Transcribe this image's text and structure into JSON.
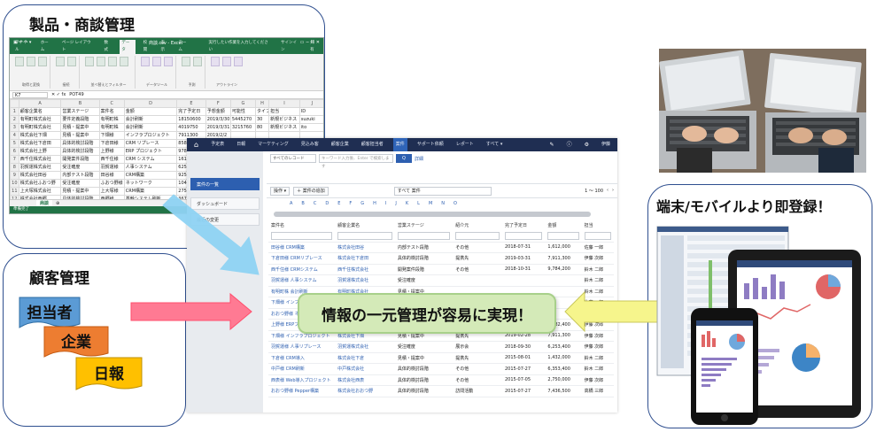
{
  "sections": {
    "product": "製品・商談管理",
    "customer": "顧客管理",
    "mobile": "端末/モバイルより即登録！"
  },
  "banner": "情報の一元管理が容易に実現！",
  "customer_tags": [
    "担当者",
    "企業",
    "日報"
  ],
  "excel": {
    "title": "商談.csv - Excel",
    "tell_me": "実行したい作業を入力してください",
    "sign_in": "サインイン",
    "share": "共有",
    "tabs": [
      "ファイル",
      "ホーム",
      "ページ レイアウト",
      "数式",
      "データ",
      "校閲",
      "表示",
      "チーム"
    ],
    "active_tab": "データ",
    "ribbon_groups": [
      "取得と変換",
      "接続",
      "並べ替えとフィルター",
      "データツール",
      "予測",
      "アウトライン"
    ],
    "name_box": "K7",
    "formula": "POT49",
    "columns": [
      "",
      "A",
      "B",
      "C",
      "D",
      "E",
      "F",
      "G",
      "H",
      "I",
      "J"
    ],
    "rows": [
      [
        "1",
        "顧客企業名",
        "営業ステージ",
        "案件名",
        "金額",
        "完了予定日",
        "予想金額",
        "可能性",
        "タイプ",
        "担当",
        "ID"
      ],
      [
        "2",
        "有明町株式会社",
        "要件定義段階",
        "有明町株",
        "会計刷新",
        "18150600",
        "2019/3/30",
        "5445270",
        "30",
        "新規ビジネス",
        "suzuki"
      ],
      [
        "3",
        "有明町株式会社",
        "見積・提案中",
        "有明町株",
        "会計刷新",
        "4019750",
        "2019/3/31",
        "3215760",
        "80",
        "新規ビジネス",
        "ito"
      ],
      [
        "4",
        "株式会社下畑",
        "見積・提案中",
        "下畑様",
        "インフラプロジェクト",
        "7911300",
        "2019/2/2",
        "",
        "",
        "",
        ""
      ],
      [
        "5",
        "株式会社下倉田",
        "具体的検討段階",
        "下倉田様",
        "CRM リプレース",
        "8582400",
        "",
        "",
        "",
        "",
        ""
      ],
      [
        "6",
        "株式会社上野",
        "具体的検討段階",
        "上野様",
        "ERP プロジェクト",
        "9784200",
        "",
        "",
        "",
        "",
        ""
      ],
      [
        "7",
        "西千住株式会社",
        "開発案件段階",
        "西千住様",
        "CRM システム",
        "1612000",
        "",
        "",
        "",
        "",
        ""
      ],
      [
        "8",
        "羽賀運株式会社",
        "受注確度",
        "羽賀運様",
        "人事システム",
        "6253400",
        "",
        "",
        "",
        "",
        ""
      ],
      [
        "9",
        "株式会社田谷",
        "内部テスト段階",
        "田谷様",
        "CRM構築",
        "9259800",
        "",
        "",
        "",
        "",
        ""
      ],
      [
        "10",
        "株式会社ふおつ野",
        "受注確度",
        "ふおつ野様",
        "ネットワーク",
        "1043900",
        "",
        "",
        "",
        "",
        ""
      ],
      [
        "11",
        "上大塚株式会社",
        "見積・提案中",
        "上大塚様",
        "CRM構築",
        "2750000",
        "",
        "",
        "",
        "",
        ""
      ],
      [
        "12",
        "株式会社西郷",
        "具体的検討段階",
        "西郷様",
        "基幹システム刷新",
        "3678000",
        "",
        "",
        "",
        "",
        ""
      ]
    ],
    "sheet": "商談",
    "status": "準備完了"
  },
  "crm": {
    "nav": [
      "予定表",
      "日報",
      "マーケティング",
      "見込み客",
      "顧客企業",
      "顧客担当者",
      "案件",
      "サポート依頼",
      "レポート",
      "すべて ▾"
    ],
    "nav_active": "案件",
    "user": "伊藤",
    "sidebar": [
      "案件の一覧",
      "ダッシュボード",
      "最近の変更"
    ],
    "search_select": "すべてのレコード",
    "search_placeholder": "キーワード入力後、Enter で検索します",
    "search_button": "Q",
    "detail_link": "詳細",
    "toolbar": {
      "ops": "操作 ▾",
      "add": "＋ 案件の追加",
      "filter": "すべて 案件",
      "paging": "1 ～ 100"
    },
    "alpha": [
      "A",
      "B",
      "C",
      "D",
      "E",
      "F",
      "G",
      "H",
      "I",
      "J",
      "K",
      "L",
      "M",
      "N",
      "O"
    ],
    "columns": [
      "案件名",
      "顧客企業名",
      "営業ステージ",
      "紹介元",
      "完了予定日",
      "金額",
      "担当"
    ],
    "rows": [
      [
        "田谷様 CRM構築",
        "株式会社田谷",
        "内部テスト段階",
        "その他",
        "2018-07-31",
        "1,612,000",
        "佐藤 一郎"
      ],
      [
        "下倉田様 CRMリプレース",
        "株式会社下倉田",
        "具体的検討段階",
        "提携先",
        "2019-03-31",
        "7,911,300",
        "伊藤 次郎"
      ],
      [
        "西千住様 CRMシステム",
        "西千住株式会社",
        "開発案件段階",
        "その他",
        "2018-10-31",
        "9,784,200",
        "鈴木 二郎"
      ],
      [
        "羽賀運様 人事システム",
        "羽賀運株式会社",
        "受注確度",
        "",
        "",
        "",
        "鈴木 二郎"
      ],
      [
        "有明町株 会計刷新",
        "有明町株式会社",
        "見積・提案中",
        "",
        "",
        "",
        "鈴木 二郎"
      ],
      [
        "下畑様 インフラ",
        "株式会社下畑",
        "見積・提案中",
        "",
        "",
        "",
        "佐藤 一郎"
      ],
      [
        "おおつ野様 ネットワーク",
        "株式会社おおつ野",
        "受注確度",
        "",
        "",
        "",
        "伊藤 次郎"
      ],
      [
        "上野様 ERPプロジェクト",
        "株式会社上野",
        "具体的検討段階",
        "Webサイト",
        "2018-12-31",
        "8,582,400",
        "伊藤 次郎"
      ],
      [
        "下畑様 インフラプロジェクト",
        "株式会社下畑",
        "見積・提案中",
        "提携先",
        "2019-02-28",
        "7,911,300",
        "伊藤 次郎"
      ],
      [
        "羽賀運様 人事リプレース",
        "羽賀運株式会社",
        "受注確度",
        "展示会",
        "2018-09-30",
        "6,253,400",
        "伊藤 次郎"
      ],
      [
        "下倉様 CRM導入",
        "株式会社下倉",
        "見積・提案中",
        "提携先",
        "2015-08-01",
        "1,432,000",
        "鈴木 二郎"
      ],
      [
        "中戸様 CRM刷新",
        "中戸株式会社",
        "具体的検討段階",
        "その他",
        "2015-07-27",
        "6,353,400",
        "鈴木 二郎"
      ],
      [
        "西表様 Web導入プロジェクト",
        "株式会社西表",
        "具体的検討段階",
        "その他",
        "2015-07-05",
        "2,750,000",
        "伊藤 次郎"
      ],
      [
        "おおつ野様 Pepper構築",
        "株式会社おおつ野",
        "具体的検討段階",
        "訪問活動",
        "2015-07-27",
        "7,436,500",
        "高橋 三郎"
      ]
    ]
  },
  "colors": {
    "frame": "#2f4f8f",
    "excel_green": "#217346",
    "crm_nav": "#1f2e52",
    "crm_blue": "#2d5fb0",
    "banner_fill": "#d4eab8",
    "tag_blue": "#5b9bd5",
    "tag_orange": "#ed7d31",
    "tag_yellow": "#ffc000",
    "arrow_pink": "#ff6f8a",
    "arrow_yellow": "#f4f48a",
    "arrow_light_blue": "#8fd3f4"
  }
}
